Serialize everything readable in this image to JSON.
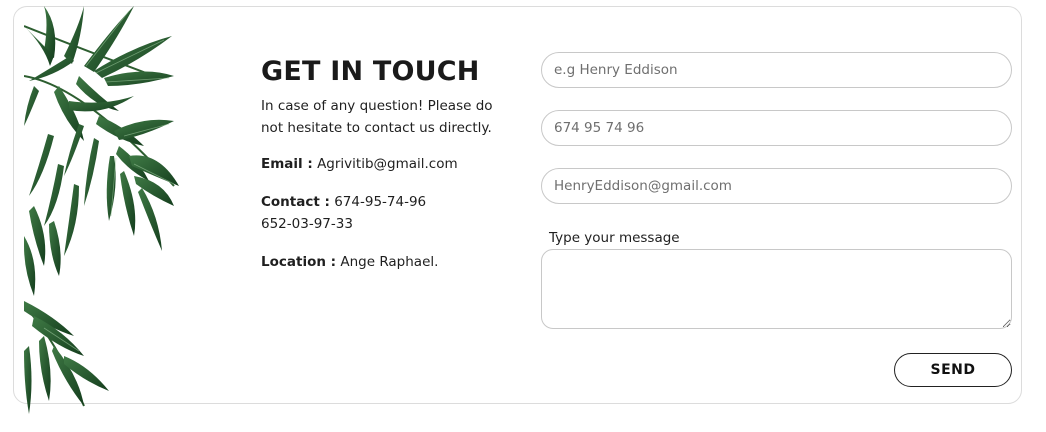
{
  "contact": {
    "title": "GET IN TOUCH",
    "intro": "In case of any question! Please do not hesitate to contact us directly.",
    "email_label": "Email :",
    "email_value": "Agrivitib@gmail.com",
    "contact_label": "Contact :",
    "phone_1": "674-95-74-96",
    "phone_2": "652-03-97-33",
    "location_label": "Location :",
    "location_value": "Ange Raphael."
  },
  "form": {
    "name_placeholder": "e.g Henry Eddison",
    "phone_placeholder": "674 95 74 96",
    "email_placeholder": "HenryEddison@gmail.com",
    "message_label": "Type your message",
    "send_label": "SEND"
  },
  "icons": {
    "decor": "palm-leaves-illustration"
  }
}
